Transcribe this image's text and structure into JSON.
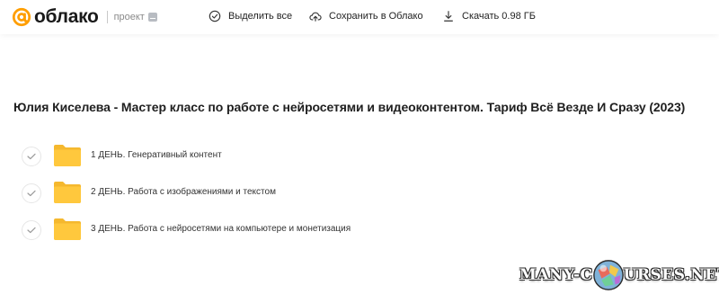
{
  "header": {
    "logo_text": "облако",
    "project_label": "проект",
    "select_all_label": "Выделить все",
    "save_label": "Сохранить в Облако",
    "download_label": "Скачать 0.98 ГБ"
  },
  "main": {
    "title": "Юлия Киселева - Мастер класс по работе с нейросетями и видеоконтентом. Тариф Всё Везде И Сразу (2023)",
    "items": [
      {
        "label": "1 ДЕНЬ. Генеративный контент",
        "type": "folder-icon"
      },
      {
        "label": "2 ДЕНЬ. Работа с изображениями и текстом",
        "type": "folder-icon"
      },
      {
        "label": "3 ДЕНЬ. Работа с нейросетями на компьютере и монетизация",
        "type": "folder-icon"
      }
    ]
  },
  "watermark": {
    "part1": "MANY-C",
    "part2": "URSES.NET"
  },
  "colors": {
    "brand_orange": "#ff9e00",
    "folder_yellow": "#ffc83d",
    "folder_back": "#f5b82e",
    "text_primary": "#1f1f1f"
  }
}
